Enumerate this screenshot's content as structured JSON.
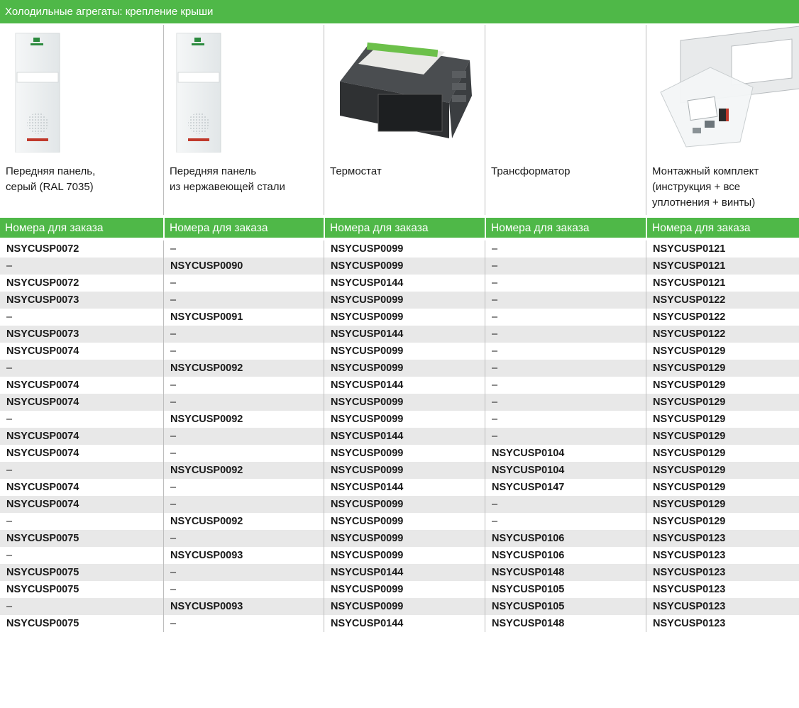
{
  "title": "Холодильные агрегаты: крепление крыши",
  "columns": [
    {
      "caption": [
        "Передняя панель,",
        "серый (RAL 7035)"
      ],
      "image": "grey-front-panel-image"
    },
    {
      "caption": [
        "Передняя панель",
        "из нержавеющей стали"
      ],
      "image": "stainless-front-panel-image"
    },
    {
      "caption": [
        "Термостат"
      ],
      "image": "thermostat-image"
    },
    {
      "caption": [
        "Трансформатор"
      ],
      "image": ""
    },
    {
      "caption": [
        "Монтажный комплект",
        "(инструкция + все",
        "уплотнения + винты)"
      ],
      "image": "mounting-kit-image"
    }
  ],
  "order_header": "Номера для заказа",
  "rows": [
    [
      "NSYCUSP0072",
      "–",
      "NSYCUSP0099",
      "–",
      "NSYCUSP0121"
    ],
    [
      "–",
      "NSYCUSP0090",
      "NSYCUSP0099",
      "–",
      "NSYCUSP0121"
    ],
    [
      "NSYCUSP0072",
      "–",
      "NSYCUSP0144",
      "–",
      "NSYCUSP0121"
    ],
    [
      "NSYCUSP0073",
      "–",
      "NSYCUSP0099",
      "–",
      "NSYCUSP0122"
    ],
    [
      "–",
      "NSYCUSP0091",
      "NSYCUSP0099",
      "–",
      "NSYCUSP0122"
    ],
    [
      "NSYCUSP0073",
      "–",
      "NSYCUSP0144",
      "–",
      "NSYCUSP0122"
    ],
    [
      "NSYCUSP0074",
      "–",
      "NSYCUSP0099",
      "–",
      "NSYCUSP0129"
    ],
    [
      "–",
      "NSYCUSP0092",
      "NSYCUSP0099",
      "–",
      "NSYCUSP0129"
    ],
    [
      "NSYCUSP0074",
      "–",
      "NSYCUSP0144",
      "–",
      "NSYCUSP0129"
    ],
    [
      "NSYCUSP0074",
      "–",
      "NSYCUSP0099",
      "–",
      "NSYCUSP0129"
    ],
    [
      "–",
      "NSYCUSP0092",
      "NSYCUSP0099",
      "–",
      "NSYCUSP0129"
    ],
    [
      "NSYCUSP0074",
      "–",
      "NSYCUSP0144",
      "–",
      "NSYCUSP0129"
    ],
    [
      "NSYCUSP0074",
      "–",
      "NSYCUSP0099",
      "NSYCUSP0104",
      "NSYCUSP0129"
    ],
    [
      "–",
      "NSYCUSP0092",
      "NSYCUSP0099",
      "NSYCUSP0104",
      "NSYCUSP0129"
    ],
    [
      "NSYCUSP0074",
      "–",
      "NSYCUSP0144",
      "NSYCUSP0147",
      "NSYCUSP0129"
    ],
    [
      "NSYCUSP0074",
      "–",
      "NSYCUSP0099",
      "–",
      "NSYCUSP0129"
    ],
    [
      "–",
      "NSYCUSP0092",
      "NSYCUSP0099",
      "–",
      "NSYCUSP0129"
    ],
    [
      "NSYCUSP0075",
      "–",
      "NSYCUSP0099",
      "NSYCUSP0106",
      "NSYCUSP0123"
    ],
    [
      "–",
      "NSYCUSP0093",
      "NSYCUSP0099",
      "NSYCUSP0106",
      "NSYCUSP0123"
    ],
    [
      "NSYCUSP0075",
      "–",
      "NSYCUSP0144",
      "NSYCUSP0148",
      "NSYCUSP0123"
    ],
    [
      "NSYCUSP0075",
      "–",
      "NSYCUSP0099",
      "NSYCUSP0105",
      "NSYCUSP0123"
    ],
    [
      "–",
      "NSYCUSP0093",
      "NSYCUSP0099",
      "NSYCUSP0105",
      "NSYCUSP0123"
    ],
    [
      "NSYCUSP0075",
      "–",
      "NSYCUSP0144",
      "NSYCUSP0148",
      "NSYCUSP0123"
    ]
  ],
  "colors": {
    "accent": "#4fb848",
    "stripe": "#e8e8e8",
    "text": "#1a1a1a"
  }
}
